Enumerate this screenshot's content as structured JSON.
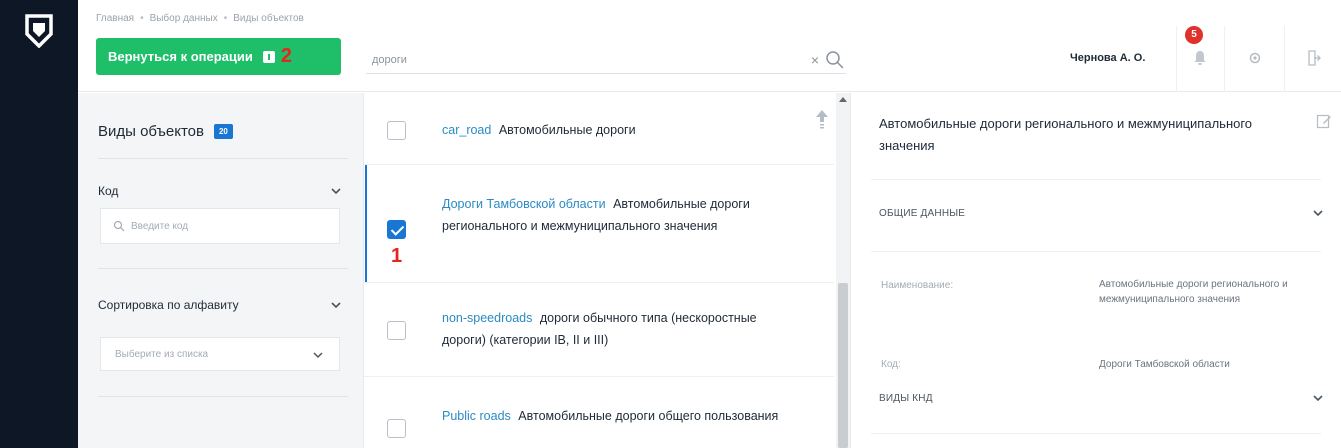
{
  "header": {
    "breadcrumb": [
      "Главная",
      "Выбор данных",
      "Виды объектов"
    ],
    "back_button_label": "Вернуться к операции",
    "callout_back": "2",
    "search": {
      "value": "дороги"
    },
    "user_name": "Чернова А. О.",
    "notifications_count": "5"
  },
  "filters": {
    "title": "Виды объектов",
    "count": "20",
    "code": {
      "label": "Код",
      "placeholder": "Введите код"
    },
    "sort": {
      "label": "Сортировка по алфавиту",
      "placeholder": "Выберите из списка"
    }
  },
  "list": {
    "items": [
      {
        "code": "car_road",
        "name": "Автомобильные дороги",
        "checked": false
      },
      {
        "code": "Дороги Тамбовской области",
        "name": "Автомобильные дороги регионального и межмуниципального значения",
        "checked": true,
        "callout": "1"
      },
      {
        "code": "non-speedroads",
        "name": "дороги обычного типа (нескоростные дороги) (категории IB, II и III)",
        "checked": false
      },
      {
        "code": "Public roads",
        "name": "Автомобильные дороги общего пользования",
        "checked": false
      }
    ]
  },
  "detail": {
    "title": "Автомобильные дороги регионального и межмуниципального значения",
    "section_general": "ОБЩИЕ ДАННЫЕ",
    "fields": [
      {
        "key": "Наименование:",
        "value": "Автомобильные дороги регионального и межмуниципального значения"
      },
      {
        "key": "Код:",
        "value": "Дороги Тамбовской области"
      }
    ],
    "section_knd": "ВИДЫ КНД"
  },
  "colors": {
    "rail": "#0d1725",
    "primary_green": "#1fbf6a",
    "accent_blue": "#1976d2",
    "code_link": "#2a8bc4",
    "badge_red": "#e0312a",
    "callout_red": "#e5261f"
  }
}
